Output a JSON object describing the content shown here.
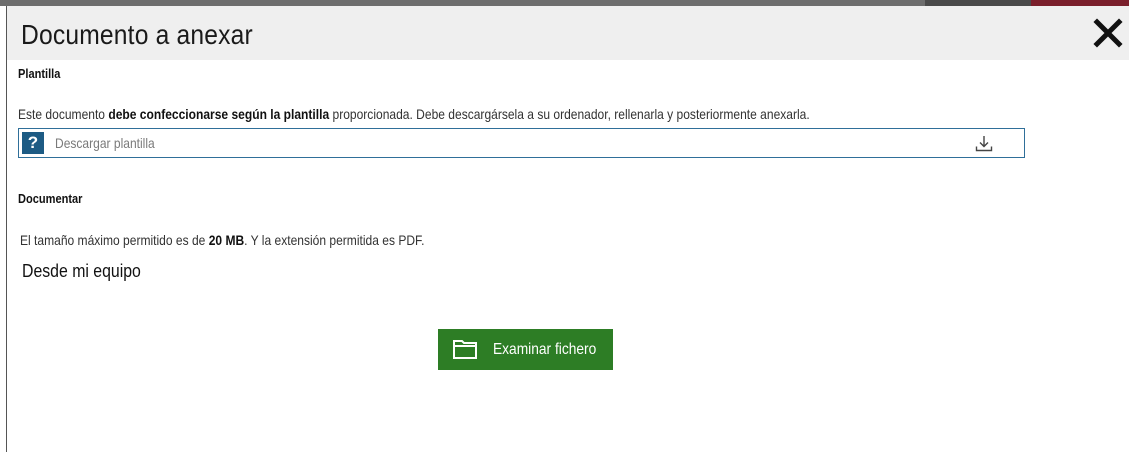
{
  "dialog": {
    "title": "Documento a anexar"
  },
  "plantilla": {
    "heading": "Plantilla",
    "text_before": "Este documento ",
    "text_bold": "debe confeccionarse según la plantilla",
    "text_after": " proporcionada. Debe descargársela a su ordenador, rellenarla y posteriormente anexarla.",
    "help_glyph": "?",
    "download_label": "Descargar plantilla"
  },
  "documentar": {
    "heading": "Documentar",
    "size_before": "El tamaño máximo permitido es de ",
    "size_bold": "20 MB",
    "size_after": ". Y la extensión permitida es PDF.",
    "source_label": "Desde mi equipo",
    "browse_label": "Examinar fichero"
  },
  "colors": {
    "browse_button": "#2d7d25",
    "help_icon": "#1d5b84",
    "header_bg": "#efefef"
  },
  "icons": {
    "close": "close-icon",
    "help": "question-icon",
    "download": "download-icon",
    "folder": "folder-icon"
  }
}
